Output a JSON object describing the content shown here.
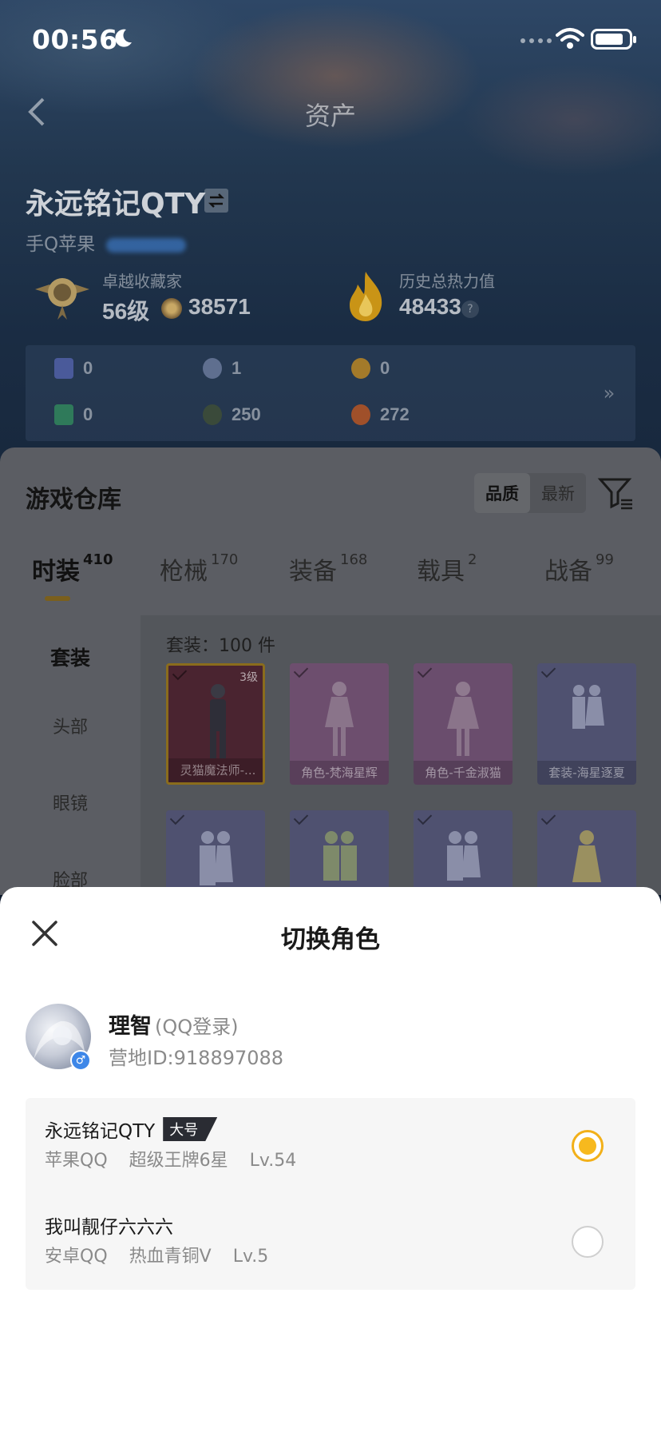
{
  "status": {
    "time": "00:56"
  },
  "header": {
    "title": "资产"
  },
  "player": {
    "name": "永远铭记QTY",
    "platform": "手Q苹果",
    "collector_title": "卓越收藏家",
    "collector_level": "56级",
    "coins": "38571",
    "heat_label": "历史总热力值",
    "heat_value": "48433",
    "help": "?"
  },
  "assets": [
    {
      "icon": "dark-card-icon",
      "value": "0",
      "color": "#4a5a9a"
    },
    {
      "icon": "clock-coin-icon",
      "value": "1",
      "color": "#5f6f8f"
    },
    {
      "icon": "gold-a-coin-icon",
      "value": "0",
      "color": "#a37a2a"
    },
    {
      "icon": "green-card-icon",
      "value": "0",
      "color": "#2f7a5a"
    },
    {
      "icon": "dark-ball-icon",
      "value": "250",
      "color": "#3a4a3a"
    },
    {
      "icon": "copper-ball-icon",
      "value": "272",
      "color": "#a0502a"
    }
  ],
  "assets_more": "»",
  "warehouse": {
    "title": "游戏仓库",
    "sort": [
      "品质",
      "最新"
    ],
    "tabs": [
      {
        "label": "时装",
        "count": "410"
      },
      {
        "label": "枪械",
        "count": "170"
      },
      {
        "label": "装备",
        "count": "168"
      },
      {
        "label": "载具",
        "count": "2"
      },
      {
        "label": "战备",
        "count": "99"
      }
    ],
    "categories": [
      "套装",
      "头部",
      "眼镜",
      "脸部"
    ],
    "count_text": "套装：100 件",
    "items": [
      {
        "caption": "灵猫魔法师-...",
        "level": "3级",
        "bg": "#4a2430"
      },
      {
        "caption": "角色-梵海星辉",
        "level": "",
        "bg": "#6d4e6e"
      },
      {
        "caption": "角色-千金淑猫",
        "level": "",
        "bg": "#6a4d6d"
      },
      {
        "caption": "套装-海星逐夏",
        "level": "",
        "bg": "#4f5170"
      },
      {
        "caption": "",
        "level": "",
        "bg": "#4f5170"
      },
      {
        "caption": "",
        "level": "",
        "bg": "#4f5170"
      },
      {
        "caption": "",
        "level": "",
        "bg": "#4f5170"
      },
      {
        "caption": "",
        "level": "",
        "bg": "#4f5170"
      }
    ]
  },
  "sheet": {
    "title": "切换角色",
    "user": {
      "name": "理智",
      "login": "(QQ登录)",
      "id": "营地ID:918897088"
    },
    "roles": [
      {
        "name": "永远铭记QTY",
        "tag": "大号",
        "platform": "苹果QQ",
        "rank": "超级王牌6星",
        "level": "Lv.54",
        "selected": true
      },
      {
        "name": "我叫靓仔六六六",
        "tag": "",
        "platform": "安卓QQ",
        "rank": "热血青铜V",
        "level": "Lv.5",
        "selected": false
      }
    ]
  },
  "colors": {
    "accent": "#f7b91e",
    "tag_bg": "#2a2c33"
  }
}
